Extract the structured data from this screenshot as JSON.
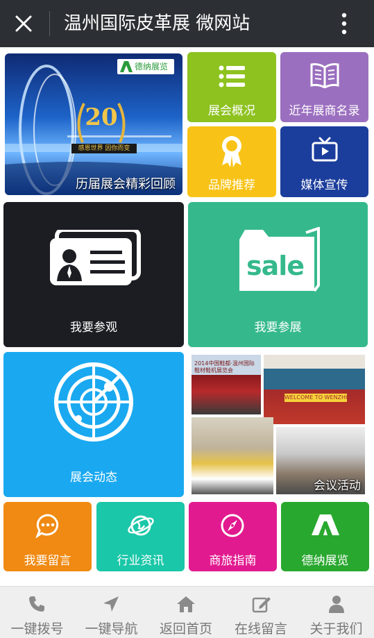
{
  "header": {
    "title": "温州国际皮革展 微网站"
  },
  "tiles": {
    "review": {
      "label": "历届展会精彩回顾",
      "banner_logo": "德纳展览",
      "badge": "20",
      "badge_slogan": "感恩世界 因你而变"
    },
    "overview": {
      "label": "展会概况",
      "icon": "list-icon",
      "color": "#8dc21f"
    },
    "exhibitors": {
      "label": "近年展商名录",
      "icon": "book-icon",
      "color": "#9b6fbf"
    },
    "brands": {
      "label": "品牌推荐",
      "icon": "award-icon",
      "color": "#f8c316"
    },
    "media": {
      "label": "媒体宣传",
      "icon": "tv-icon",
      "color": "#1b3d9c"
    },
    "visit": {
      "label": "我要参观",
      "icon": "business-card-icon",
      "color": "#1c1d22"
    },
    "exhibit": {
      "label": "我要参展",
      "icon": "sale-folder-icon",
      "sale_text": "sale",
      "color": "#35b98c"
    },
    "news": {
      "label": "展会动态",
      "icon": "radar-icon",
      "color": "#1aa9f0"
    },
    "meeting": {
      "label": "会议活动",
      "photo_text": "2014中国鞋都·温州国际鞋材鞋机展览会",
      "welcome_text": "WELCOME TO WENZHOU"
    },
    "message": {
      "label": "我要留言",
      "icon": "chat-bubble-icon",
      "color": "#f08a12"
    },
    "industry": {
      "label": "行业资讯",
      "icon": "globe-icon",
      "color": "#1ac7a8"
    },
    "travel": {
      "label": "商旅指南",
      "icon": "compass-icon",
      "color": "#e21a8f"
    },
    "dena": {
      "label": "德纳展览",
      "icon": "dena-logo-icon",
      "color": "#29a82f"
    }
  },
  "bottom_nav": [
    {
      "label": "一键拨号",
      "icon": "phone-icon"
    },
    {
      "label": "一键导航",
      "icon": "navigation-arrow-icon"
    },
    {
      "label": "返回首页",
      "icon": "home-icon"
    },
    {
      "label": "在线留言",
      "icon": "edit-icon"
    },
    {
      "label": "关于我们",
      "icon": "user-icon"
    }
  ]
}
